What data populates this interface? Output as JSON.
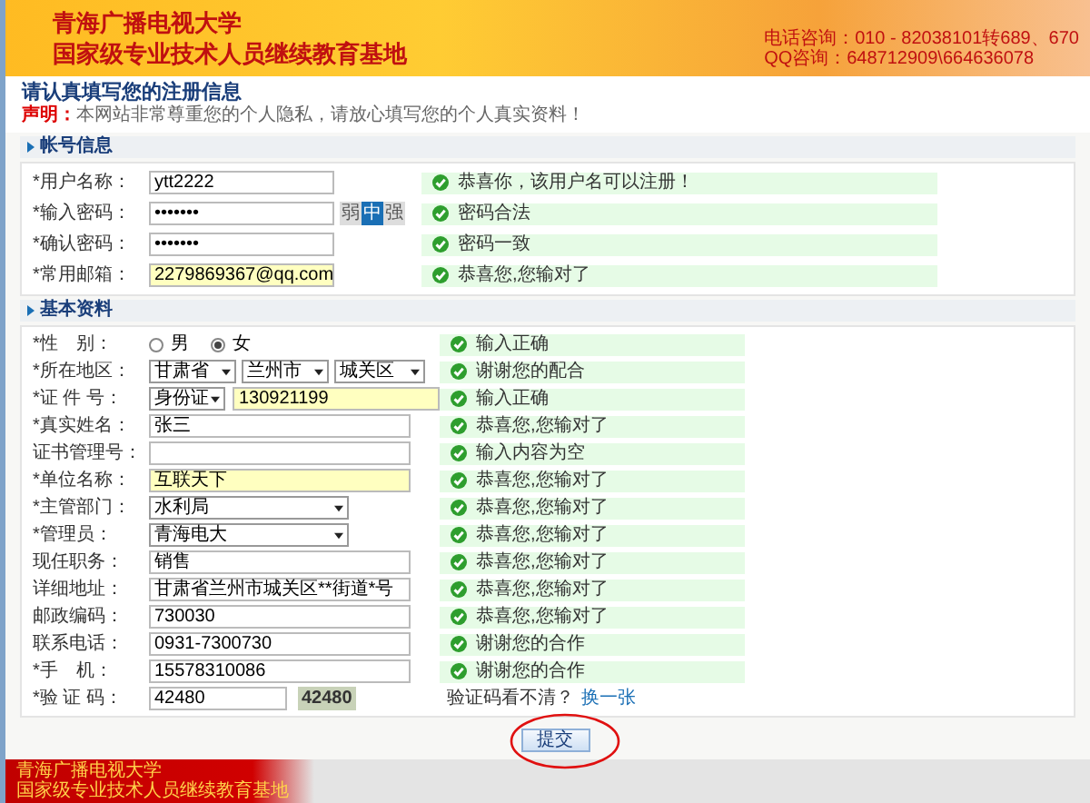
{
  "header": {
    "school": "青海广播电视大学",
    "subtitle": "国家级专业技术人员继续教育基地",
    "phone": "电话咨询：010 - 82038101转689、670",
    "qq": "QQ咨询：648712909\\664636078"
  },
  "page_title": "请认真填写您的注册信息",
  "notice": {
    "label": "声明：",
    "text": "本网站非常尊重您的个人隐私，请放心填写您的个人真实资料！"
  },
  "sections": [
    {
      "title": "帐号信息",
      "rows": [
        {
          "kind": "text",
          "label": "*用户名称：",
          "value": "ytt2222",
          "highlighted": false,
          "message": "恭喜你，该用户名可以注册！"
        },
        {
          "kind": "password",
          "label": "*输入密码：",
          "value": "•••••••",
          "strength": [
            {
              "label": "弱",
              "selected": false
            },
            {
              "label": "中",
              "selected": true
            },
            {
              "label": "强",
              "selected": false
            }
          ],
          "message": "密码合法"
        },
        {
          "kind": "password",
          "label": "*确认密码：",
          "value": "•••••••",
          "message": "密码一致"
        },
        {
          "kind": "text",
          "label": "*常用邮箱：",
          "value": "2279869367@qq.com",
          "highlighted": true,
          "message": "恭喜您,您输对了"
        }
      ]
    },
    {
      "title": "基本资料",
      "rows": [
        {
          "kind": "radio",
          "label": "*性　别：",
          "options": [
            {
              "label": "男",
              "selected": false
            },
            {
              "label": "女",
              "selected": true
            }
          ],
          "message": "输入正确"
        },
        {
          "kind": "selects",
          "label": "*所在地区：",
          "selects": [
            "甘肃省",
            "兰州市",
            "城关区"
          ],
          "message": "谢谢您的配合"
        },
        {
          "kind": "id",
          "label": "*证 件 号：",
          "id_type": "身份证",
          "value": "130921199",
          "highlighted": true,
          "message": "输入正确"
        },
        {
          "kind": "text",
          "label": "*真实姓名：",
          "value": "张三",
          "highlighted": false,
          "message": "恭喜您,您输对了"
        },
        {
          "kind": "text",
          "label": "证书管理号：",
          "value": "",
          "highlighted": false,
          "message": "输入内容为空"
        },
        {
          "kind": "text",
          "label": "*单位名称：",
          "value": "互联天下",
          "highlighted": true,
          "message": "恭喜您,您输对了"
        },
        {
          "kind": "select",
          "label": "*主管部门：",
          "value": "水利局",
          "message": "恭喜您,您输对了"
        },
        {
          "kind": "select",
          "label": "*管理员：",
          "value": "青海电大",
          "message": "恭喜您,您输对了"
        },
        {
          "kind": "text",
          "label": "现任职务：",
          "value": "销售",
          "highlighted": false,
          "message": "恭喜您,您输对了"
        },
        {
          "kind": "text",
          "label": "详细地址：",
          "value": "甘肃省兰州市城关区**街道*号",
          "highlighted": false,
          "message": "恭喜您,您输对了"
        },
        {
          "kind": "text",
          "label": "邮政编码：",
          "value": "730030",
          "highlighted": false,
          "message": "恭喜您,您输对了"
        },
        {
          "kind": "text",
          "label": "联系电话：",
          "value": "0931-7300730",
          "highlighted": false,
          "message": "谢谢您的合作"
        },
        {
          "kind": "text",
          "label": "*手　机：",
          "value": "15578310086",
          "highlighted": false,
          "message": "谢谢您的合作"
        },
        {
          "kind": "captcha",
          "label": "*验 证 码：",
          "value": "42480",
          "captcha_image": "42480",
          "hint": "验证码看不清？",
          "link": "换一张"
        }
      ]
    }
  ],
  "submit": "提交",
  "footer": [
    "青海广播电视大学",
    "国家级专业技术人员继续教育基地"
  ]
}
